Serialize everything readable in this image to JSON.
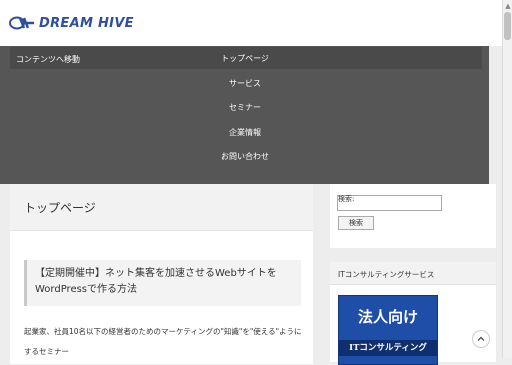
{
  "site": {
    "brand": "DREAM HIVE"
  },
  "nav": {
    "skip_link": "コンテンツへ移動",
    "items": [
      "トップページ",
      "サービス",
      "セミナー",
      "企業情報",
      "お問い合わせ"
    ]
  },
  "main": {
    "page_title": "トップページ",
    "post_title": "【定期開催中】ネット集客を加速させるWebサイトをWordPressで作る方法",
    "post_desc": "起業家、社員10名以下の経営者のためのマーケティングの\"知識\"を\"使える\"ようにするセミナー"
  },
  "sidebar": {
    "search_label": "検索:",
    "search_value": "",
    "search_button": "検索",
    "widget_title": "ITコンサルティングサービス",
    "banner_line1": "法人向け",
    "banner_line2": "ITコンサルティング"
  },
  "colors": {
    "brand": "#2f4f9a",
    "nav_bg": "#565656",
    "banner": "#1f4ea8"
  },
  "icons": {
    "logo": "dh-logo-icon",
    "back_to_top": "chevron-up-icon",
    "scroll_up": "scroll-up-arrow-icon"
  }
}
